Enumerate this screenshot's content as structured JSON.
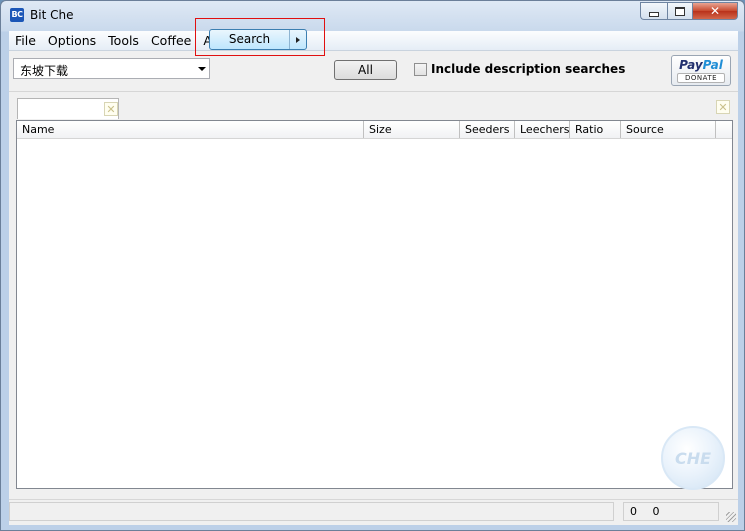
{
  "window": {
    "title": "Bit Che",
    "app_icon_text": "BC",
    "icons": {
      "minimize": "minimize-icon",
      "maximize": "maximize-icon",
      "close": "close-icon"
    }
  },
  "menu": {
    "items": [
      "File",
      "Options",
      "Tools",
      "Coffee",
      "About"
    ]
  },
  "toolbar": {
    "search_query": "东坡下载",
    "search_button": "Search",
    "all_button": "All",
    "include_description_label": "Include description searches",
    "include_description_checked": false,
    "paypal": {
      "brand_a": "Pay",
      "brand_b": "Pal",
      "donate": "DONATE"
    }
  },
  "results": {
    "columns": [
      "Name",
      "Size",
      "Seeders",
      "Leechers",
      "Ratio",
      "Source"
    ],
    "rows": []
  },
  "tab": {
    "label": ""
  },
  "status": {
    "count_a": "0",
    "count_b": "0"
  },
  "watermark": "CHE",
  "colors": {
    "highlight_border": "#e01010",
    "search_button": "#bee6fd",
    "close_button": "#c7482d"
  }
}
